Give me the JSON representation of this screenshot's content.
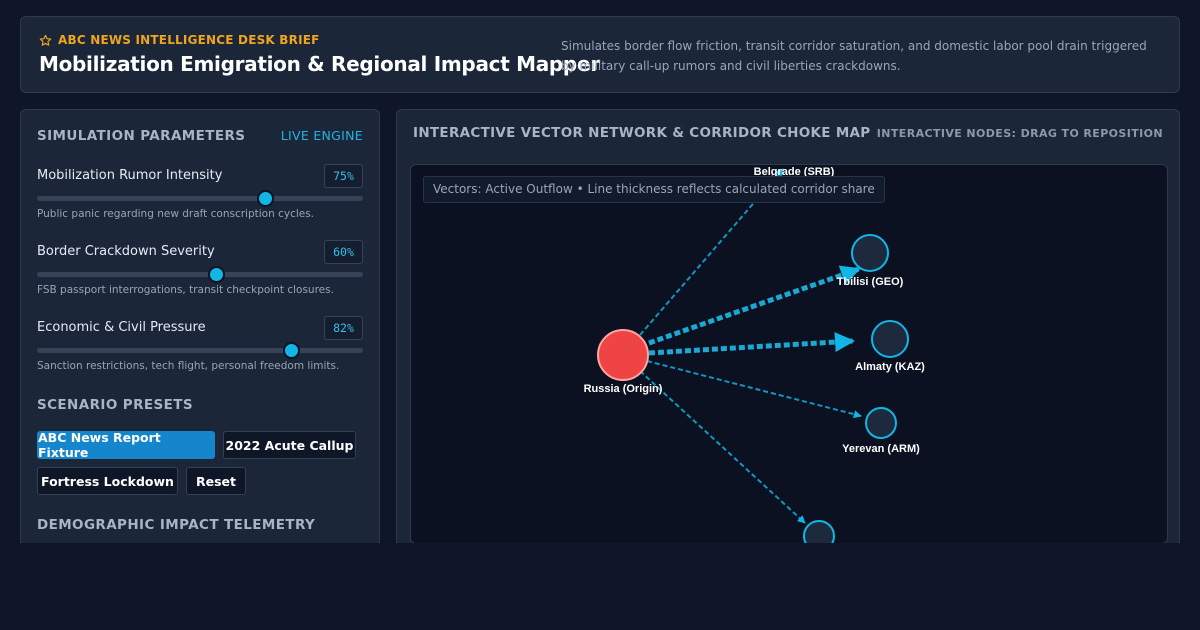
{
  "header": {
    "brief_label": "ABC NEWS INTELLIGENCE DESK BRIEF",
    "title": "Mobilization Emigration & Regional Impact Mapper",
    "description": "Simulates border flow friction, transit corridor saturation, and domestic labor pool drain triggered by military call-up rumors and civil liberties crackdowns."
  },
  "parameters": {
    "heading": "SIMULATION PARAMETERS",
    "status": "LIVE ENGINE",
    "items": [
      {
        "label": "Mobilization Rumor Intensity",
        "value_text": "75%",
        "value": 0.7,
        "description": "Public panic regarding new draft conscription cycles."
      },
      {
        "label": "Border Crackdown Severity",
        "value_text": "60%",
        "value": 0.55,
        "description": "FSB passport interrogations, transit checkpoint closures."
      },
      {
        "label": "Economic & Civil Pressure",
        "value_text": "82%",
        "value": 0.78,
        "description": "Sanction restrictions, tech flight, personal freedom limits."
      }
    ]
  },
  "presets": {
    "heading": "SCENARIO PRESETS",
    "buttons": [
      "ABC News Report Fixture",
      "2022 Acute Callup",
      "Fortress Lockdown",
      "Reset"
    ],
    "active": "ABC News Report Fixture"
  },
  "telemetry": {
    "heading": "DEMOGRAPHIC IMPACT TELEMETRY"
  },
  "map": {
    "title": "INTERACTIVE VECTOR NETWORK & CORRIDOR CHOKE MAP",
    "hint": "INTERACTIVE NODES: DRAG TO REPOSITION",
    "legend": "Vectors: Active Outflow • Line thickness reflects calculated corridor share",
    "origin": "Russia (Origin)",
    "destinations": [
      "Belgrade (SRB)",
      "Tbilisi (GEO)",
      "Almaty (KAZ)",
      "Yerevan (ARM)",
      ""
    ]
  },
  "colors": {
    "accent": "#12b6e6",
    "brand": "#f0a51e",
    "origin_node": "#ef4444",
    "button_primary": "#1586cc"
  }
}
